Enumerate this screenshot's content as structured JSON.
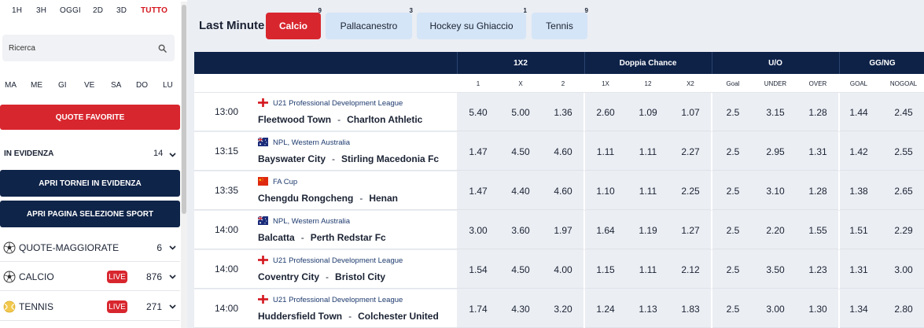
{
  "sidebar": {
    "time_filters": [
      "1H",
      "3H",
      "OGGI",
      "2D",
      "3D",
      "TUTTO"
    ],
    "active_time_filter": "TUTTO",
    "search_placeholder": "Ricerca",
    "weekdays": [
      "MA",
      "ME",
      "GI",
      "VE",
      "SA",
      "DO",
      "LU"
    ],
    "quote_favorite_label": "QUOTE FAVORITE",
    "in_evidenza_label": "IN EVIDENZA",
    "in_evidenza_count": "14",
    "apri_tornei_label": "APRI TORNEI IN EVIDENZA",
    "apri_pagina_label": "APRI PAGINA SELEZIONE SPORT",
    "sports": [
      {
        "label": "QUOTE-MAGGIORATE",
        "count": "6",
        "live": false,
        "icon": "soccer-ball-icon"
      },
      {
        "label": "CALCIO",
        "count": "876",
        "live": true,
        "live_label": "LIVE",
        "icon": "soccer-ball-icon"
      },
      {
        "label": "TENNIS",
        "count": "271",
        "live": true,
        "live_label": "LIVE",
        "icon": "tennis-ball-icon"
      }
    ]
  },
  "main": {
    "title": "Last Minute",
    "tabs": [
      {
        "label": "Calcio",
        "count": "9",
        "active": true
      },
      {
        "label": "Pallacanestro",
        "count": "3",
        "active": false
      },
      {
        "label": "Hockey su Ghiaccio",
        "count": "1",
        "active": false
      },
      {
        "label": "Tennis",
        "count": "9",
        "active": false
      }
    ],
    "groups": [
      {
        "label": "1X2",
        "subs": [
          "1",
          "X",
          "2"
        ]
      },
      {
        "label": "Doppia Chance",
        "subs": [
          "1X",
          "12",
          "X2"
        ]
      },
      {
        "label": "U/O",
        "subs": [
          "Goal",
          "UNDER",
          "OVER"
        ]
      },
      {
        "label": "GG/NG",
        "subs": [
          "GOAL",
          "NOGOAL"
        ]
      }
    ],
    "matches": [
      {
        "time": "13:00",
        "flag": "england",
        "league": "U21 Professional Development League",
        "home": "Fleetwood Town",
        "away": "Charlton Athletic",
        "sep": "-",
        "odds": [
          "5.40",
          "5.00",
          "1.36",
          "2.60",
          "1.09",
          "1.07",
          "2.5",
          "3.15",
          "1.28",
          "1.44",
          "2.45"
        ]
      },
      {
        "time": "13:15",
        "flag": "australia",
        "league": "NPL, Western Australia",
        "home": "Bayswater City",
        "away": "Stirling Macedonia Fc",
        "sep": "-",
        "odds": [
          "1.47",
          "4.50",
          "4.60",
          "1.11",
          "1.11",
          "2.27",
          "2.5",
          "2.95",
          "1.31",
          "1.42",
          "2.55"
        ]
      },
      {
        "time": "13:35",
        "flag": "china",
        "league": "FA Cup",
        "home": "Chengdu Rongcheng",
        "away": "Henan",
        "sep": "-",
        "odds": [
          "1.47",
          "4.40",
          "4.60",
          "1.10",
          "1.11",
          "2.25",
          "2.5",
          "3.10",
          "1.28",
          "1.38",
          "2.65"
        ]
      },
      {
        "time": "14:00",
        "flag": "australia",
        "league": "NPL, Western Australia",
        "home": "Balcatta",
        "away": "Perth Redstar Fc",
        "sep": "-",
        "odds": [
          "3.00",
          "3.60",
          "1.97",
          "1.64",
          "1.19",
          "1.27",
          "2.5",
          "2.20",
          "1.55",
          "1.51",
          "2.29"
        ]
      },
      {
        "time": "14:00",
        "flag": "england",
        "league": "U21 Professional Development League",
        "home": "Coventry City",
        "away": "Bristol City",
        "sep": "-",
        "odds": [
          "1.54",
          "4.50",
          "4.00",
          "1.15",
          "1.11",
          "2.12",
          "2.5",
          "3.50",
          "1.23",
          "1.31",
          "3.00"
        ]
      },
      {
        "time": "14:00",
        "flag": "england",
        "league": "U21 Professional Development League",
        "home": "Huddersfield Town",
        "away": "Colchester United",
        "sep": "-",
        "odds": [
          "1.74",
          "4.30",
          "3.20",
          "1.24",
          "1.13",
          "1.83",
          "2.5",
          "3.00",
          "1.30",
          "1.34",
          "2.80"
        ]
      }
    ]
  },
  "colors": {
    "accent_red": "#d8262e",
    "navy": "#0e2248",
    "tab_blue": "#d4e5f7",
    "odds_bg": "#ebeef3"
  }
}
